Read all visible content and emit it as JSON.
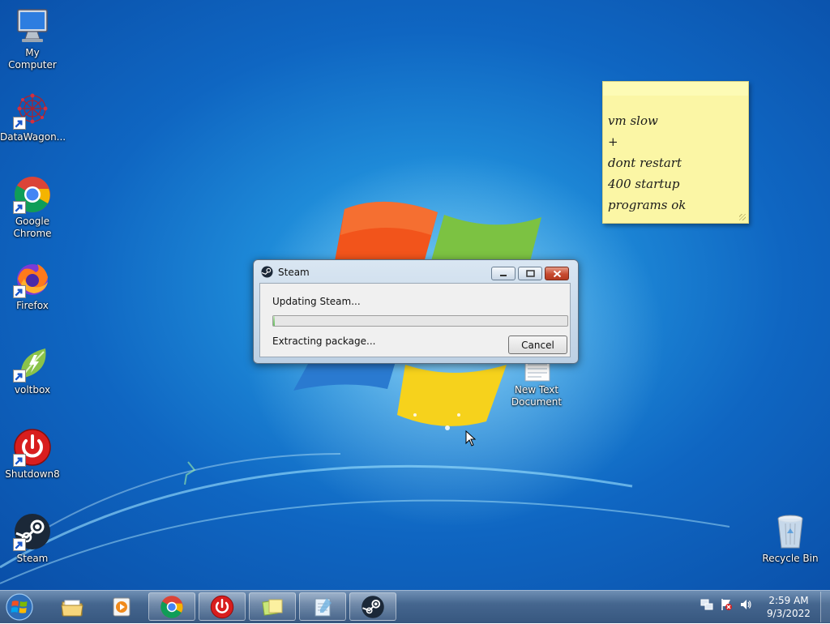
{
  "desktop": {
    "icons": [
      {
        "label": "My Computer",
        "icon": "computer-icon",
        "shortcut": false
      },
      {
        "label": "DataWagon...",
        "icon": "datawagon-icon",
        "shortcut": true
      },
      {
        "label": "Google Chrome",
        "icon": "chrome-icon",
        "shortcut": true
      },
      {
        "label": "Firefox",
        "icon": "firefox-icon",
        "shortcut": true
      },
      {
        "label": "voltbox",
        "icon": "voltbox-icon",
        "shortcut": true
      },
      {
        "label": "Shutdown8",
        "icon": "power-icon",
        "shortcut": true
      },
      {
        "label": "Steam",
        "icon": "steam-icon",
        "shortcut": true
      },
      {
        "label": "New Text Document",
        "icon": "text-document-icon",
        "shortcut": false
      },
      {
        "label": "Recycle Bin",
        "icon": "recycle-bin-icon",
        "shortcut": false
      }
    ]
  },
  "sticky_note": {
    "lines": [
      "vm slow",
      "+",
      "dont restart",
      "400 startup",
      "programs  ok"
    ],
    "color": "#fbf6a5"
  },
  "dialog": {
    "title": "Steam",
    "status_text": "Updating Steam...",
    "progress_fraction": 0.0,
    "sub_status": "Extracting package...",
    "cancel_label": "Cancel"
  },
  "taskbar": {
    "items": [
      {
        "icon": "file-explorer-icon",
        "active": false
      },
      {
        "icon": "media-player-icon",
        "active": false
      },
      {
        "icon": "chrome-icon",
        "active": true
      },
      {
        "icon": "power-icon",
        "active": true
      },
      {
        "icon": "sticky-notes-icon",
        "active": true
      },
      {
        "icon": "notepad-icon",
        "active": true
      },
      {
        "icon": "steam-icon",
        "active": true
      }
    ],
    "tray_icons": [
      "network-icon",
      "action-center-flag-icon",
      "volume-icon"
    ],
    "clock": {
      "time": "2:59 AM",
      "date": "9/3/2022"
    }
  },
  "colors": {
    "desktop_blue": "#1e8ad8",
    "close_red": "#c74b30"
  }
}
